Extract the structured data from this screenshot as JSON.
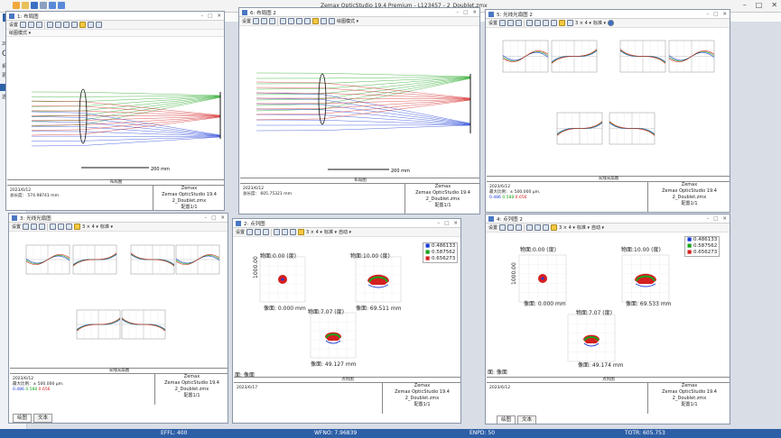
{
  "app": {
    "title": "Zemax OpticStudio 19.4    Premium - L123457 - 2_Doublet.zmx",
    "file_tab": "文件"
  },
  "left_panel": {
    "items": [
      "2D显",
      "O",
      "系统",
      "更新",
      "透光"
    ]
  },
  "status": {
    "effl": "EFFL: 400",
    "wfno": "WFNO: 7.96839",
    "enpd": "ENPD: 50",
    "totr": "TOTR: 605.753"
  },
  "toolbar": {
    "settings": "设置",
    "draw_mode": "绘图模式 ▾",
    "standard": "标准 ▾",
    "auto": "自动 ▾",
    "grid": "3 × 4 ▾"
  },
  "windows": {
    "layout1": {
      "title": "1: 布局图",
      "caption": "布局图",
      "date": "2023/6/12",
      "info": "总长度：   574.98741 mm",
      "scale": "200 mm",
      "company": "Zemax",
      "product": "Zemax OpticStudio 19.4",
      "file": "2_Doublet.zmx",
      "config": "配置1/1"
    },
    "layout2": {
      "title": "6: 布局图 2",
      "caption": "布局图",
      "date": "2023/6/12",
      "info": "总长度：   605.75321 mm",
      "scale": "200 mm",
      "company": "Zemax",
      "product": "Zemax OpticStudio 19.4",
      "file": "2_Doublet.zmx",
      "config": "配置1/1"
    },
    "fan2": {
      "title": "5: 光线光扇图 2",
      "caption": "光线光扇图",
      "date": "2023/6/12",
      "info": "最大比例：± 500.000 µm.",
      "w": [
        "0.486",
        "0.588",
        "0.656"
      ],
      "company": "Zemax",
      "product": "Zemax OpticStudio 19.4",
      "file": "2_Doublet.zmx",
      "config": "配置1/1"
    },
    "fan1": {
      "title": "3: 光线光扇图",
      "caption": "光线光扇图",
      "date": "2023/6/12",
      "info": "最大比例：± 500.000 µm.",
      "w": [
        "0.486",
        "0.588",
        "0.656"
      ],
      "company": "Zemax",
      "product": "Zemax OpticStudio 19.4",
      "file": "2_Doublet.zmx",
      "config": "配置1/1"
    },
    "spot1": {
      "title": "2: 点列图",
      "caption": "点列图",
      "obj0": "物面:0.00 (度)",
      "obj10": "物面:10.00 (度)",
      "obj7": "物面:7.07 (度)",
      "img0": "像面: 0.000 mm",
      "img10": "像面: 69.511 mm",
      "img7": "像面: 49.127 mm",
      "ylabel": "1000.00",
      "surface": "面: 像面",
      "legend": [
        "0.486133",
        "0.587562",
        "0.656273"
      ],
      "date": "2023/6/17",
      "company": "Zemax",
      "product": "Zemax OpticStudio 19.4",
      "file": "2_Doublet.zmx",
      "config": "配置1/1"
    },
    "spot2": {
      "title": "4: 点列图 2",
      "caption": "点列图",
      "obj0": "物面:0.00 (度)",
      "obj10": "物面:10.00 (度)",
      "obj7": "物面:7.07 (度)",
      "img0": "像面: 0.000 mm",
      "img10": "像面: 69.533 mm",
      "img7": "像面: 49.174 mm",
      "ylabel": "1000.00",
      "surface": "面: 像面",
      "legend": [
        "0.486133",
        "0.587562",
        "0.656273"
      ],
      "date": "2023/6/12",
      "company": "Zemax",
      "product": "Zemax OpticStudio 19.4",
      "file": "2_Doublet.zmx",
      "config": "配置1/1"
    }
  },
  "tabs": {
    "draw": "绘图",
    "text": "文本"
  },
  "colors": {
    "blue": "#1a3bd6",
    "green": "#1aa31a",
    "red": "#d42020"
  }
}
